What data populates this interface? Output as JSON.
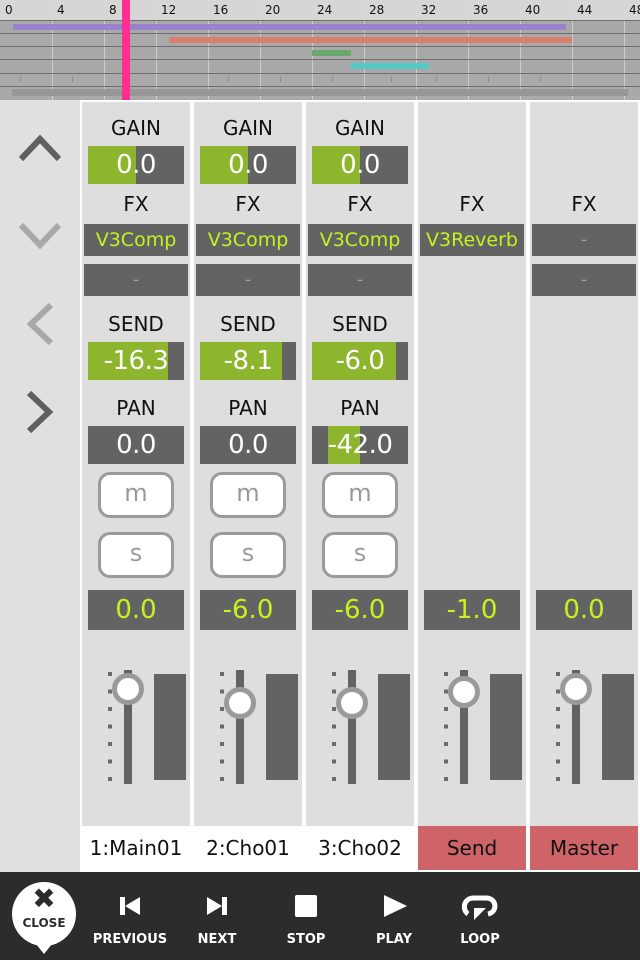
{
  "timeline": {
    "ruler_labels": [
      "0",
      "4",
      "8",
      "12",
      "16",
      "20",
      "24",
      "28",
      "32",
      "36",
      "40",
      "44",
      "48"
    ],
    "playhead_bar": 9.4,
    "playhead_color": "#ff2f92",
    "clips": [
      {
        "lane": 0,
        "start_bar": 1.0,
        "end_bar": 43.5,
        "color": "#9b82cf"
      },
      {
        "lane": 1,
        "start_bar": 13.0,
        "end_bar": 44.0,
        "color": "#d9806c"
      },
      {
        "lane": 2,
        "start_bar": 24.0,
        "end_bar": 27.0,
        "color": "#6ba86e"
      },
      {
        "lane": 3,
        "start_bar": 27.0,
        "end_bar": 33.0,
        "color": "#55c8c8"
      }
    ],
    "marker_bars": [
      1.0,
      5.0,
      17.0,
      21.0,
      25.0,
      29.5,
      33.0,
      37.0,
      41.0
    ]
  },
  "nav": {
    "up": "chevron-up-icon",
    "down": "chevron-down-icon",
    "left": "chevron-left-icon",
    "right": "chevron-right-icon"
  },
  "labels": {
    "gain": "GAIN",
    "fx": "FX",
    "send": "SEND",
    "pan": "PAN",
    "mute": "m",
    "solo": "s"
  },
  "channels": [
    {
      "name": "1:Main01",
      "type": "track",
      "gain": "0.0",
      "gain_fill": 0.5,
      "fx1": "V3Comp",
      "fx2": "-",
      "send": "-16.3",
      "send_fill": 0.83,
      "pan": "0.0",
      "pan_fill_from": 0.5,
      "pan_fill_to": 0.5,
      "level": "0.0",
      "fader_pos": 0.17
    },
    {
      "name": "2:Cho01",
      "type": "track",
      "gain": "0.0",
      "gain_fill": 0.5,
      "fx1": "V3Comp",
      "fx2": "-",
      "send": "-8.1",
      "send_fill": 0.85,
      "pan": "0.0",
      "pan_fill_from": 0.5,
      "pan_fill_to": 0.5,
      "level": "-6.0",
      "fader_pos": 0.29
    },
    {
      "name": "3:Cho02",
      "type": "track",
      "gain": "0.0",
      "gain_fill": 0.5,
      "fx1": "V3Comp",
      "fx2": "-",
      "send": "-6.0",
      "send_fill": 0.88,
      "pan": "-42.0",
      "pan_fill_from": 0.17,
      "pan_fill_to": 0.5,
      "level": "-6.0",
      "fader_pos": 0.29
    },
    {
      "name": "Send",
      "type": "bus",
      "fx1": "V3Reverb",
      "level": "-1.0",
      "fader_pos": 0.19
    },
    {
      "name": "Master",
      "type": "bus",
      "fx1": "-",
      "fx2": "-",
      "level": "0.0",
      "fader_pos": 0.17
    }
  ],
  "colors": {
    "bus_name_bg": "#cf6468",
    "value_green": "#c6f21e",
    "fill_green": "#8db52e"
  },
  "transport": {
    "close_label": "CLOSE",
    "buttons": [
      {
        "id": "previous",
        "label": "PREVIOUS",
        "icon": "skip-previous-icon"
      },
      {
        "id": "next",
        "label": "NEXT",
        "icon": "skip-next-icon"
      },
      {
        "id": "stop",
        "label": "STOP",
        "icon": "stop-icon"
      },
      {
        "id": "play",
        "label": "PLAY",
        "icon": "play-icon"
      },
      {
        "id": "loop",
        "label": "LOOP",
        "icon": "loop-icon"
      }
    ]
  }
}
